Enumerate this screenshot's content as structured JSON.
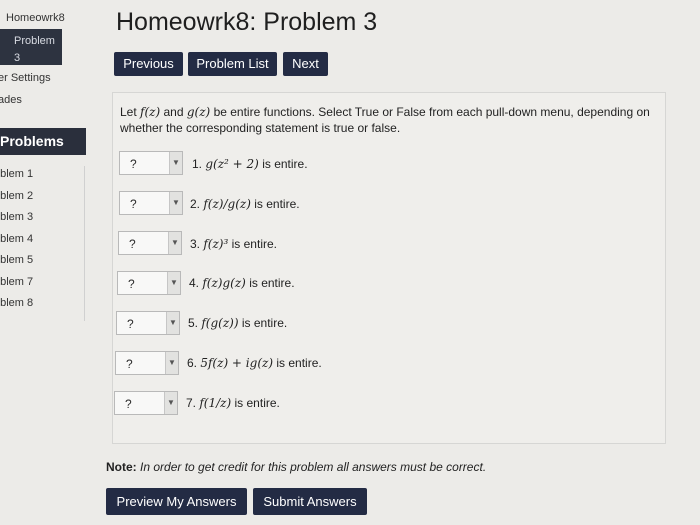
{
  "sidebar": {
    "crumb": "Homeowrk8",
    "current_item": {
      "line1": "Problem",
      "line2": "3"
    },
    "user_settings": "er Settings",
    "grades": "ades",
    "problems_heading": "Problems",
    "problems": [
      "oblem 1",
      "oblem 2",
      "oblem 3",
      "oblem 4",
      "oblem 5",
      "oblem 7",
      "oblem 8"
    ]
  },
  "header": {
    "title": "Homeowrk8: Problem 3"
  },
  "nav": {
    "previous": "Previous",
    "problem_list": "Problem List",
    "next": "Next"
  },
  "problem": {
    "intro_pre": "Let ",
    "intro_f": "f(z)",
    "intro_and": " and ",
    "intro_g": "g(z)",
    "intro_post": " be entire functions. Select True or False from each pull-down menu, depending on whether the corresponding statement is true or false.",
    "select_value": "?",
    "items": [
      {
        "num": "1.",
        "expr": "g(z² + 2)",
        "suffix": " is entire."
      },
      {
        "num": "2.",
        "expr": "f(z)/g(z)",
        "suffix": " is entire."
      },
      {
        "num": "3.",
        "expr": "f(z)³",
        "suffix": " is entire."
      },
      {
        "num": "4.",
        "expr": "f(z)g(z)",
        "suffix": " is entire."
      },
      {
        "num": "5.",
        "expr": "f(g(z))",
        "suffix": " is entire."
      },
      {
        "num": "6.",
        "expr": "5f(z) + ig(z)",
        "suffix": " is entire."
      },
      {
        "num": "7.",
        "expr": "f(1/z)",
        "suffix": " is entire."
      }
    ]
  },
  "note": {
    "label": "Note:",
    "text": " In order to get credit for this problem all answers must be correct."
  },
  "actions": {
    "preview": "Preview My Answers",
    "submit": "Submit Answers"
  }
}
